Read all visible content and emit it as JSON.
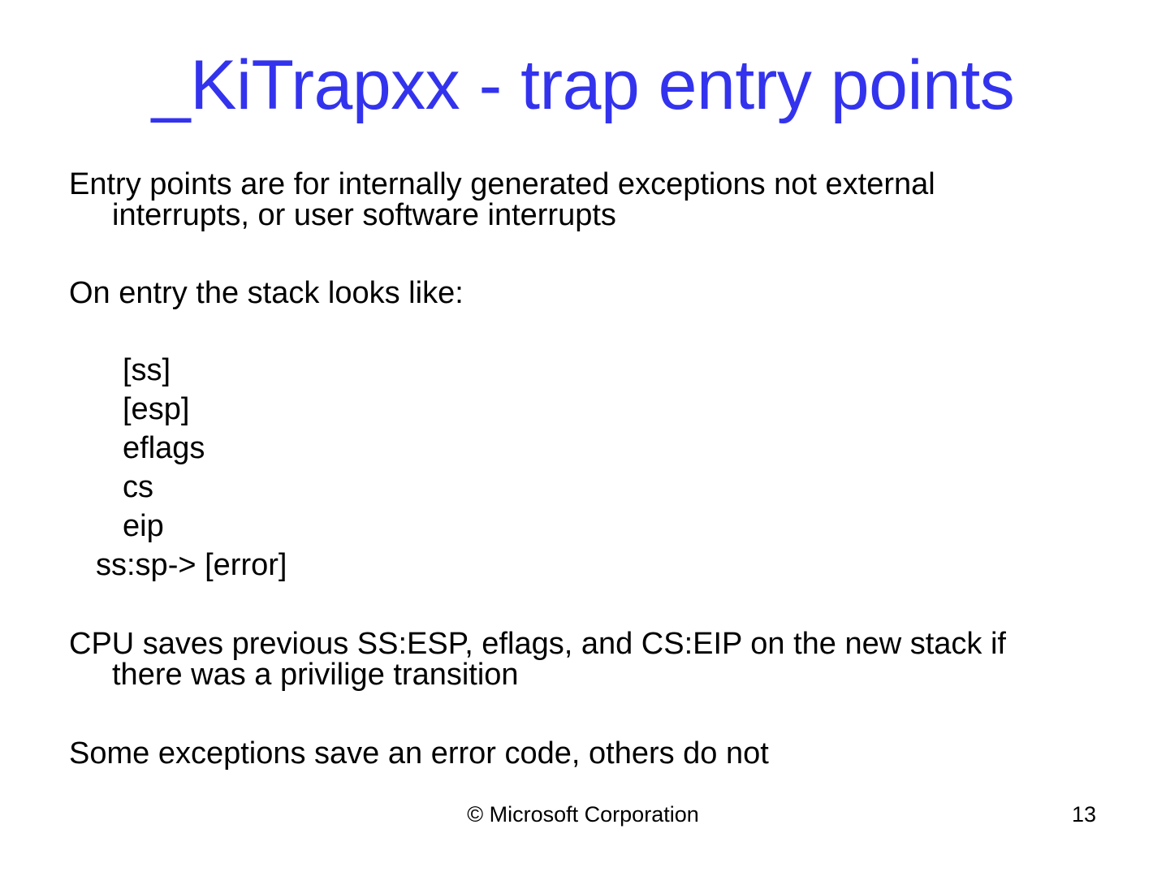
{
  "slide": {
    "title": "_KiTrapxx - trap entry points",
    "paragraph1": {
      "line1": "Entry points are for internally generated exceptions not external",
      "line2": "interrupts, or user software interrupts"
    },
    "paragraph2": "On entry the stack looks like:",
    "stack_lines": [
      "[ss]",
      "[esp]",
      "eflags",
      "cs",
      "eip",
      "ss:sp-> [error]"
    ],
    "paragraph3": {
      "line1": "CPU saves previous SS:ESP, eflags, and CS:EIP on  the new stack if",
      "line2": "there was a privilige transition"
    },
    "paragraph4": "Some exceptions save an error code, others do not",
    "footer": "© Microsoft Corporation",
    "page_number": "13",
    "colors": {
      "title": "#3333ee",
      "text": "#000000",
      "background": "#ffffff"
    }
  }
}
